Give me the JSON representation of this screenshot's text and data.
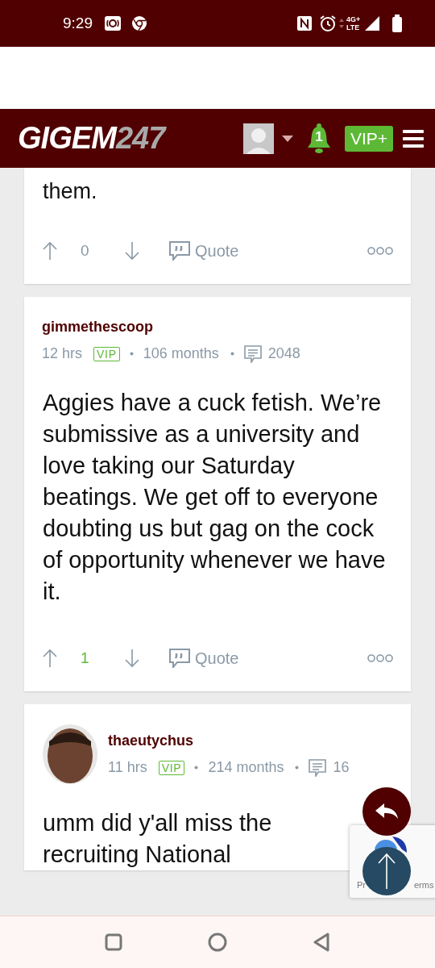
{
  "status_bar": {
    "time": "9:29",
    "network": "4G+ LTE"
  },
  "header": {
    "logo_main": "GIGEM",
    "logo_suffix": "247",
    "notifications": "1",
    "vip_button": "VIP+"
  },
  "posts": [
    {
      "kind": "tail",
      "body": "them.",
      "score": "0",
      "upvoted": false,
      "quote": "Quote"
    },
    {
      "kind": "full",
      "author": "gimmethescoop",
      "has_avatar": false,
      "time": "12 hrs",
      "badge": "VIP",
      "tenure": "106 months",
      "post_count": "2048",
      "body": "Aggies have a cuck fetish. We’re submissive as a university and love taking our Saturday beatings. We get off to everyone doubting us but gag on the cock of opportunity whenever we have it.",
      "score": "1",
      "upvoted": true,
      "quote": "Quote"
    },
    {
      "kind": "head",
      "author": "thaeutychus",
      "has_avatar": true,
      "time": "11 hrs",
      "badge": "VIP",
      "tenure": "214 months",
      "post_count": "16",
      "body": "umm did y'all miss the recruiting National"
    }
  ],
  "recaptcha": {
    "text_left": "Pr",
    "text_right": "erms"
  }
}
